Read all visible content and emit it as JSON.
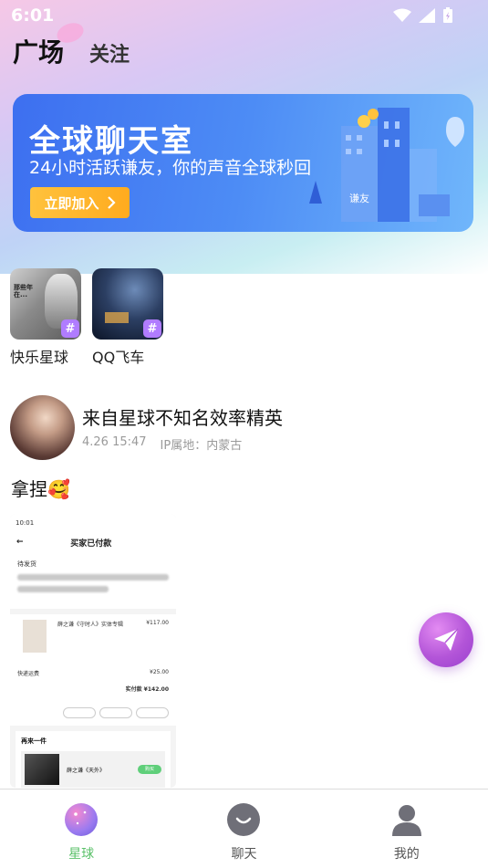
{
  "status_bar": {
    "time": "6:01"
  },
  "header": {
    "tabs": [
      {
        "label": "广场",
        "active": true
      },
      {
        "label": "关注",
        "active": false
      }
    ]
  },
  "banner": {
    "title": "全球聊天室",
    "subtitle": "24小时活跃谦友，你的声音全球秒回",
    "button_label": "立即加入",
    "building_sign": "谦友",
    "colors": {
      "background": "#3d6ff0",
      "button": "#ffab1e"
    }
  },
  "rooms": [
    {
      "label": "快乐星球",
      "thumb_text": "那些年 在..."
    },
    {
      "label": "QQ飞车"
    }
  ],
  "post": {
    "author": "来自星球不知名效率精英",
    "date": "4.26 15:47",
    "ip_location": "IP属地：内蒙古",
    "text": "拿捏🥰",
    "image": {
      "status_time": "10:01",
      "page_title": "买家已付款",
      "status": "待发货",
      "product": "薛之谦《守时人》实体专辑",
      "product_price": "¥117.00",
      "shipping": "快递运费",
      "shipping_price": "¥25.00",
      "total": "实付款 ¥142.00",
      "buy_again": "再来一件",
      "rec_product": "薛之谦《天外》",
      "rec_button": "购买"
    }
  },
  "bottom_nav": {
    "items": [
      {
        "label": "星球",
        "icon": "planet-icon",
        "active": true
      },
      {
        "label": "聊天",
        "icon": "chat-face-icon",
        "active": false
      },
      {
        "label": "我的",
        "icon": "user-icon",
        "active": false
      }
    ],
    "active_color": "#5bc16a"
  },
  "fab": {
    "icon": "send-icon",
    "color": "#b355d8"
  }
}
